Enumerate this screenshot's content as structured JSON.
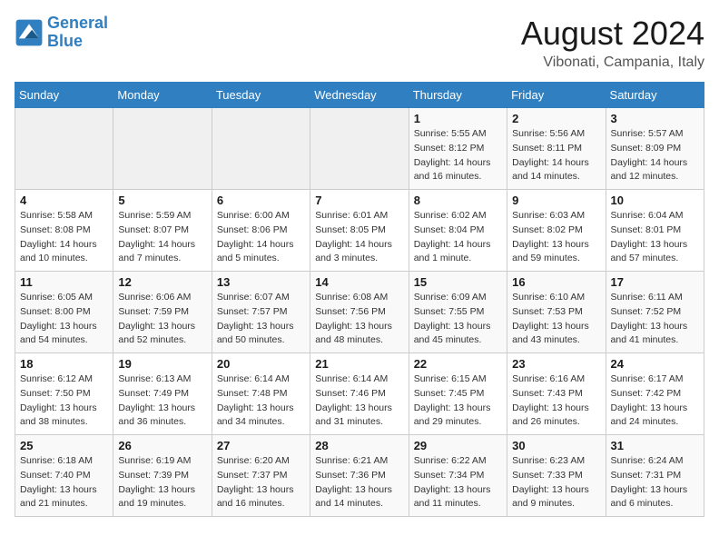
{
  "header": {
    "logo_line1": "General",
    "logo_line2": "Blue",
    "month_year": "August 2024",
    "location": "Vibonati, Campania, Italy"
  },
  "weekdays": [
    "Sunday",
    "Monday",
    "Tuesday",
    "Wednesday",
    "Thursday",
    "Friday",
    "Saturday"
  ],
  "weeks": [
    [
      {
        "day": "",
        "info": ""
      },
      {
        "day": "",
        "info": ""
      },
      {
        "day": "",
        "info": ""
      },
      {
        "day": "",
        "info": ""
      },
      {
        "day": "1",
        "info": "Sunrise: 5:55 AM\nSunset: 8:12 PM\nDaylight: 14 hours\nand 16 minutes."
      },
      {
        "day": "2",
        "info": "Sunrise: 5:56 AM\nSunset: 8:11 PM\nDaylight: 14 hours\nand 14 minutes."
      },
      {
        "day": "3",
        "info": "Sunrise: 5:57 AM\nSunset: 8:09 PM\nDaylight: 14 hours\nand 12 minutes."
      }
    ],
    [
      {
        "day": "4",
        "info": "Sunrise: 5:58 AM\nSunset: 8:08 PM\nDaylight: 14 hours\nand 10 minutes."
      },
      {
        "day": "5",
        "info": "Sunrise: 5:59 AM\nSunset: 8:07 PM\nDaylight: 14 hours\nand 7 minutes."
      },
      {
        "day": "6",
        "info": "Sunrise: 6:00 AM\nSunset: 8:06 PM\nDaylight: 14 hours\nand 5 minutes."
      },
      {
        "day": "7",
        "info": "Sunrise: 6:01 AM\nSunset: 8:05 PM\nDaylight: 14 hours\nand 3 minutes."
      },
      {
        "day": "8",
        "info": "Sunrise: 6:02 AM\nSunset: 8:04 PM\nDaylight: 14 hours\nand 1 minute."
      },
      {
        "day": "9",
        "info": "Sunrise: 6:03 AM\nSunset: 8:02 PM\nDaylight: 13 hours\nand 59 minutes."
      },
      {
        "day": "10",
        "info": "Sunrise: 6:04 AM\nSunset: 8:01 PM\nDaylight: 13 hours\nand 57 minutes."
      }
    ],
    [
      {
        "day": "11",
        "info": "Sunrise: 6:05 AM\nSunset: 8:00 PM\nDaylight: 13 hours\nand 54 minutes."
      },
      {
        "day": "12",
        "info": "Sunrise: 6:06 AM\nSunset: 7:59 PM\nDaylight: 13 hours\nand 52 minutes."
      },
      {
        "day": "13",
        "info": "Sunrise: 6:07 AM\nSunset: 7:57 PM\nDaylight: 13 hours\nand 50 minutes."
      },
      {
        "day": "14",
        "info": "Sunrise: 6:08 AM\nSunset: 7:56 PM\nDaylight: 13 hours\nand 48 minutes."
      },
      {
        "day": "15",
        "info": "Sunrise: 6:09 AM\nSunset: 7:55 PM\nDaylight: 13 hours\nand 45 minutes."
      },
      {
        "day": "16",
        "info": "Sunrise: 6:10 AM\nSunset: 7:53 PM\nDaylight: 13 hours\nand 43 minutes."
      },
      {
        "day": "17",
        "info": "Sunrise: 6:11 AM\nSunset: 7:52 PM\nDaylight: 13 hours\nand 41 minutes."
      }
    ],
    [
      {
        "day": "18",
        "info": "Sunrise: 6:12 AM\nSunset: 7:50 PM\nDaylight: 13 hours\nand 38 minutes."
      },
      {
        "day": "19",
        "info": "Sunrise: 6:13 AM\nSunset: 7:49 PM\nDaylight: 13 hours\nand 36 minutes."
      },
      {
        "day": "20",
        "info": "Sunrise: 6:14 AM\nSunset: 7:48 PM\nDaylight: 13 hours\nand 34 minutes."
      },
      {
        "day": "21",
        "info": "Sunrise: 6:14 AM\nSunset: 7:46 PM\nDaylight: 13 hours\nand 31 minutes."
      },
      {
        "day": "22",
        "info": "Sunrise: 6:15 AM\nSunset: 7:45 PM\nDaylight: 13 hours\nand 29 minutes."
      },
      {
        "day": "23",
        "info": "Sunrise: 6:16 AM\nSunset: 7:43 PM\nDaylight: 13 hours\nand 26 minutes."
      },
      {
        "day": "24",
        "info": "Sunrise: 6:17 AM\nSunset: 7:42 PM\nDaylight: 13 hours\nand 24 minutes."
      }
    ],
    [
      {
        "day": "25",
        "info": "Sunrise: 6:18 AM\nSunset: 7:40 PM\nDaylight: 13 hours\nand 21 minutes."
      },
      {
        "day": "26",
        "info": "Sunrise: 6:19 AM\nSunset: 7:39 PM\nDaylight: 13 hours\nand 19 minutes."
      },
      {
        "day": "27",
        "info": "Sunrise: 6:20 AM\nSunset: 7:37 PM\nDaylight: 13 hours\nand 16 minutes."
      },
      {
        "day": "28",
        "info": "Sunrise: 6:21 AM\nSunset: 7:36 PM\nDaylight: 13 hours\nand 14 minutes."
      },
      {
        "day": "29",
        "info": "Sunrise: 6:22 AM\nSunset: 7:34 PM\nDaylight: 13 hours\nand 11 minutes."
      },
      {
        "day": "30",
        "info": "Sunrise: 6:23 AM\nSunset: 7:33 PM\nDaylight: 13 hours\nand 9 minutes."
      },
      {
        "day": "31",
        "info": "Sunrise: 6:24 AM\nSunset: 7:31 PM\nDaylight: 13 hours\nand 6 minutes."
      }
    ]
  ]
}
